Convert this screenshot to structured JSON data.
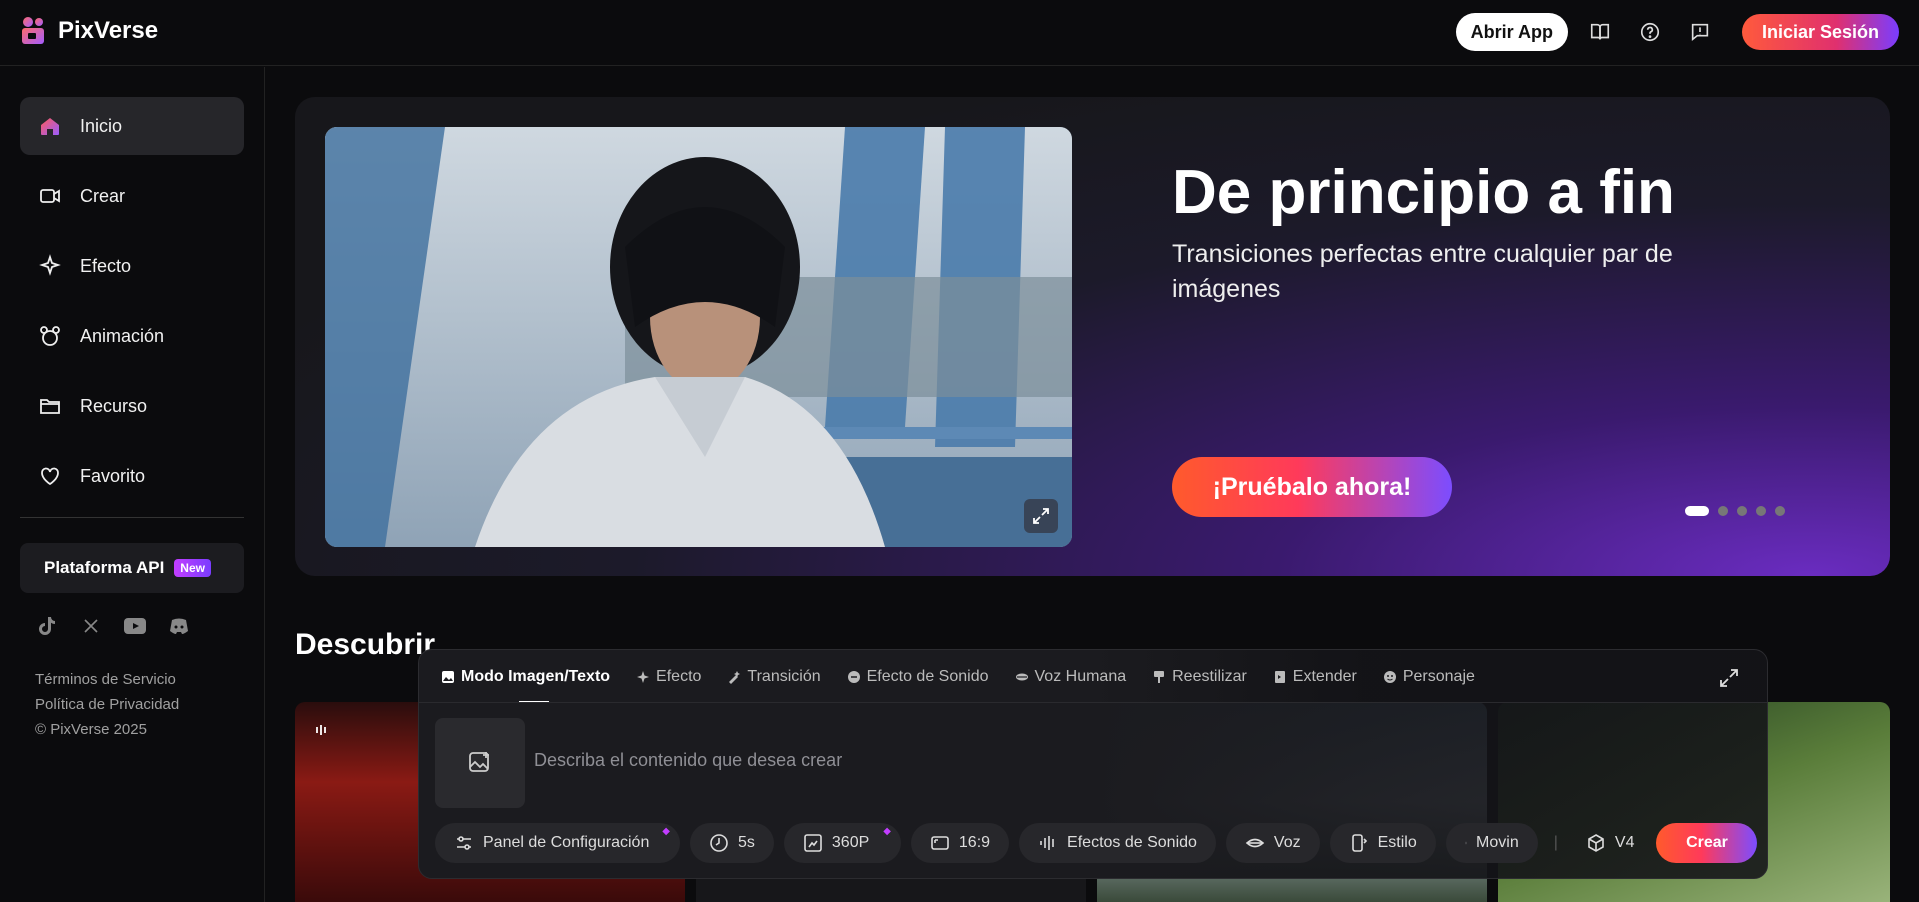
{
  "header": {
    "logo_text": "PixVerse",
    "open_app": "Abrir App",
    "sign_in": "Iniciar Sesión"
  },
  "sidebar": {
    "items": [
      {
        "label": "Inicio",
        "icon": "home-icon"
      },
      {
        "label": "Crear",
        "icon": "video-camera-icon"
      },
      {
        "label": "Efecto",
        "icon": "sparkle-icon"
      },
      {
        "label": "Animación",
        "icon": "mouse-icon"
      },
      {
        "label": "Recurso",
        "icon": "folder-icon"
      },
      {
        "label": "Favorito",
        "icon": "heart-icon"
      }
    ],
    "api_label": "Plataforma API",
    "api_badge": "New",
    "legal": [
      "Términos de Servicio",
      "Política de Privacidad",
      "© PixVerse 2025"
    ]
  },
  "hero": {
    "title": "De principio a fin",
    "subtitle": "Transiciones perfectas entre cualquier par de imágenes",
    "cta": "¡Pruébalo ahora!",
    "slides_total": 5,
    "active_slide": 1
  },
  "discover": {
    "title": "Descubrir"
  },
  "composer": {
    "tabs": [
      {
        "label": "Modo Imagen/Texto",
        "icon": "image-icon"
      },
      {
        "label": "Efecto",
        "icon": "sparkle-icon"
      },
      {
        "label": "Transición",
        "icon": "magic-icon"
      },
      {
        "label": "Efecto de Sonido",
        "icon": "sound-icon"
      },
      {
        "label": "Voz Humana",
        "icon": "lips-icon"
      },
      {
        "label": "Reestilizar",
        "icon": "brush-icon"
      },
      {
        "label": "Extender",
        "icon": "extend-icon"
      },
      {
        "label": "Personaje",
        "icon": "face-icon"
      }
    ],
    "prompt_placeholder": "Describa el contenido que desea crear",
    "controls": {
      "settings": "Panel de Configuración",
      "duration": "5s",
      "quality": "360P",
      "ratio": "16:9",
      "sound": "Efectos de Sonido",
      "voice": "Voz",
      "style": "Estilo",
      "moving": "Movin",
      "version": "V4",
      "create": "Crear"
    }
  },
  "colors": {
    "accent_start": "#ff5a2c",
    "accent_end": "#7c4dff",
    "background": "#0b0b0d"
  }
}
